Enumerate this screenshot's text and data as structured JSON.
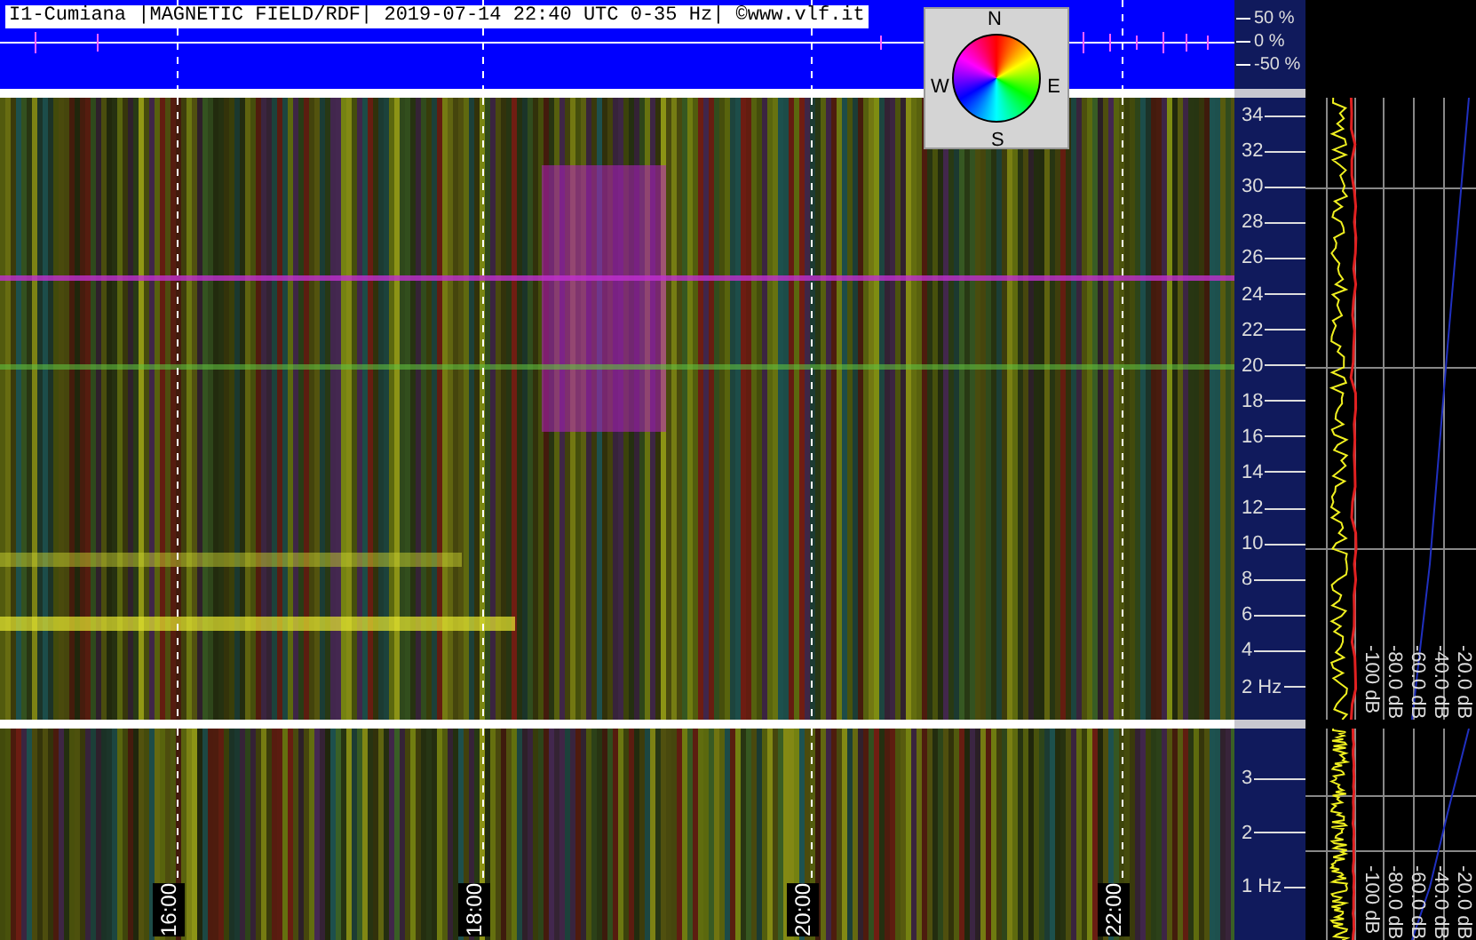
{
  "header": {
    "title": "I1-Cumiana |MAGNETIC FIELD/RDF| 2019-07-14 22:40 UTC 0-35 Hz| ©www.vlf.it",
    "amplitude_ticks": [
      "50 %",
      "0 %",
      "-50 %"
    ]
  },
  "compass": {
    "labels": [
      "N",
      "E",
      "S",
      "W"
    ]
  },
  "upper": {
    "freq_ticks": [
      "34",
      "32",
      "30",
      "28",
      "26",
      "24",
      "22",
      "20",
      "18",
      "16",
      "14",
      "12",
      "10",
      "8",
      "6",
      "4",
      "2 Hz"
    ],
    "db_labels": [
      "-100 dB",
      "-80.0 dB",
      "-60.0 dB",
      "-40.0 dB",
      "-20.0 dB"
    ]
  },
  "lower": {
    "freq_ticks": [
      "3",
      "2",
      "1 Hz"
    ],
    "db_labels": [
      "-100 dB",
      "-80.0 dB",
      "-60.0 dB",
      "-40.0 dB",
      "-20.0 dB"
    ],
    "time_labels": [
      "16:00",
      "18:00",
      "20:00",
      "22:00"
    ]
  }
}
